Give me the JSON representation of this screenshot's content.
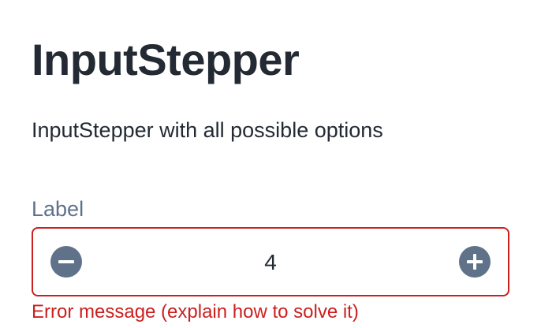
{
  "page": {
    "title": "InputStepper",
    "description": "InputStepper with all possible options"
  },
  "stepper": {
    "label": "Label",
    "value": "4",
    "decrement_icon": "minus-circle-icon",
    "increment_icon": "plus-circle-icon",
    "error_message": "Error message (explain how to solve it)",
    "colors": {
      "error": "#cc1f1f",
      "icon": "#5f7289",
      "label": "#5f7289",
      "text": "#232a33"
    }
  }
}
